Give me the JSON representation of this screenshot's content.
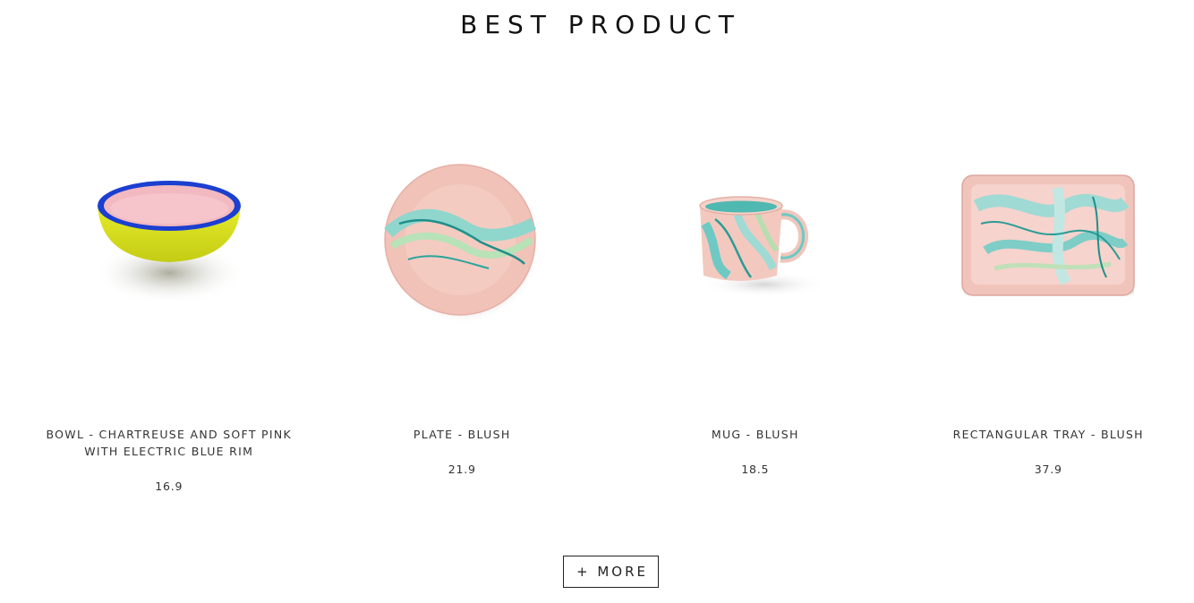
{
  "section": {
    "title": "BEST PRODUCT"
  },
  "products": [
    {
      "name": "BOWL - CHARTREUSE AND SOFT PINK WITH ELECTRIC BLUE RIM",
      "price": "16.9",
      "image": "bowl-image"
    },
    {
      "name": "PLATE - BLUSH",
      "price": "21.9",
      "image": "plate-image"
    },
    {
      "name": "MUG - BLUSH",
      "price": "18.5",
      "image": "mug-image"
    },
    {
      "name": "RECTANGULAR TRAY - BLUSH",
      "price": "37.9",
      "image": "tray-image"
    }
  ],
  "more_button": {
    "label": "+ MORE"
  },
  "colors": {
    "blush": "#f3c4bd",
    "teal": "#6ec9c4",
    "chartreuse": "#d9e21c",
    "electric_blue": "#1b3fd0",
    "soft_pink": "#f2b9c1"
  }
}
